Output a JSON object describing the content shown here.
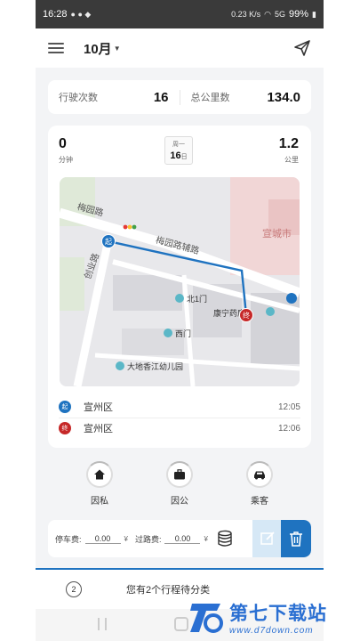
{
  "status_bar": {
    "time": "16:28",
    "net_speed": "0.23 K/s",
    "signal": "5G",
    "battery": "99%"
  },
  "header": {
    "month": "10月"
  },
  "stats": {
    "trips_label": "行驶次数",
    "trips_value": "16",
    "km_label": "总公里数",
    "km_value": "134.0"
  },
  "trip": {
    "minutes_value": "0",
    "minutes_unit": "分钟",
    "weekday": "周一",
    "day": "16",
    "day_unit": "日",
    "km_value": "1.2",
    "km_unit": "公里",
    "map_labels": {
      "road1": "梅园路",
      "road2": "梅园路辅路",
      "road3": "创业路",
      "city": "宣城市",
      "gate_north": "北1门",
      "gate_west": "西门",
      "pharmacy": "康宁药房",
      "kindergarten": "大地香江幼儿园",
      "start_marker": "起",
      "end_marker": "终"
    },
    "start": {
      "place": "宣州区",
      "time": "12:05"
    },
    "end": {
      "place": "宣州区",
      "time": "12:06"
    }
  },
  "categories": [
    {
      "label": "因私"
    },
    {
      "label": "因公"
    },
    {
      "label": "乘客"
    }
  ],
  "fees": {
    "parking_label": "停车费:",
    "parking_value": "0.00",
    "toll_label": "过路费:",
    "toll_value": "0.00",
    "currency": "¥"
  },
  "pending_text": "您有2个行程待分类",
  "pending_count": "2",
  "watermark": {
    "title": "第七下载站",
    "url": "www.d7down.com"
  },
  "colors": {
    "accent": "#1f73c0",
    "route": "#1f73c0",
    "end_marker": "#c62828"
  }
}
